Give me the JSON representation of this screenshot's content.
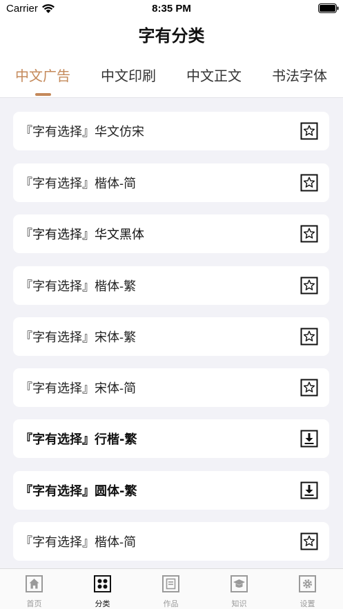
{
  "status_bar": {
    "carrier": "Carrier",
    "time": "8:35 PM"
  },
  "header": {
    "title": "字有分类"
  },
  "tabs": [
    {
      "label": "中文广告",
      "active": true
    },
    {
      "label": "中文印刷",
      "active": false
    },
    {
      "label": "中文正文",
      "active": false
    },
    {
      "label": "书法字体",
      "active": false
    }
  ],
  "fonts": [
    {
      "label": "『字有选择』华文仿宋",
      "action": "star-icon"
    },
    {
      "label": "『字有选择』楷体-简",
      "action": "star-icon"
    },
    {
      "label": "『字有选择』华文黑体",
      "action": "star-icon"
    },
    {
      "label": "『字有选择』楷体-繁",
      "action": "star-icon"
    },
    {
      "label": "『字有选择』宋体-繁",
      "action": "star-icon"
    },
    {
      "label": "『字有选择』宋体-简",
      "action": "star-icon"
    },
    {
      "label": "『字有选择』行楷-繁",
      "action": "download-icon"
    },
    {
      "label": "『字有选择』圆体-繁",
      "action": "download-icon"
    },
    {
      "label": "『字有选择』楷体-简",
      "action": "star-icon"
    }
  ],
  "tabbar": [
    {
      "label": "首页",
      "icon": "home-icon",
      "active": false
    },
    {
      "label": "分类",
      "icon": "category-icon",
      "active": true
    },
    {
      "label": "作品",
      "icon": "works-icon",
      "active": false
    },
    {
      "label": "知识",
      "icon": "knowledge-icon",
      "active": false
    },
    {
      "label": "设置",
      "icon": "settings-icon",
      "active": false
    }
  ],
  "colors": {
    "accent": "#c4895a",
    "background": "#f2f2f7",
    "card": "#ffffff"
  }
}
